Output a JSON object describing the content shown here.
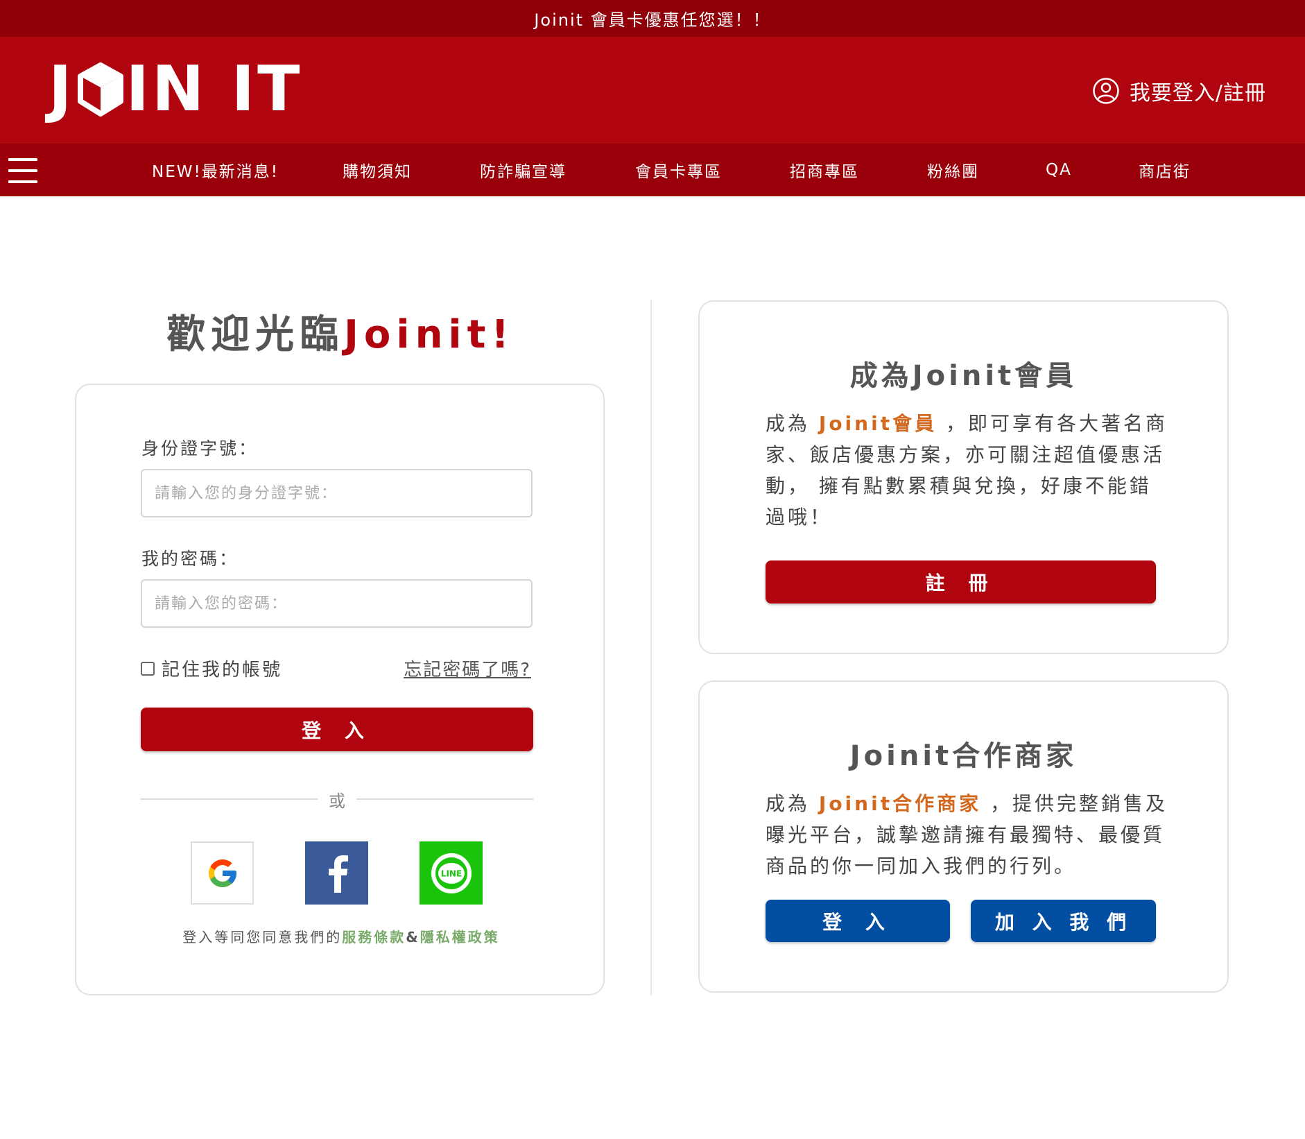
{
  "announcement": "Joinit 會員卡優惠任您選！！",
  "logo": {
    "left": "J",
    "middle": "IN IT"
  },
  "header": {
    "login_label": "我要登入/註冊"
  },
  "nav": {
    "items": [
      "NEW!最新消息!",
      "購物須知",
      "防詐騙宣導",
      "會員卡專區",
      "招商專區",
      "粉絲團",
      "QA",
      "商店街"
    ]
  },
  "welcome": {
    "prefix": "歡迎光臨",
    "brand": "Joinit!"
  },
  "login_form": {
    "id_label": "身份證字號：",
    "id_placeholder": "請輸入您的身分證字號：",
    "password_label": "我的密碼：",
    "password_placeholder": "請輸入您的密碼：",
    "remember_label": "記住我的帳號",
    "forgot_label": "忘記密碼了嗎?",
    "submit_label": "登 入",
    "or_label": "或",
    "agree_prefix": "登入等同您同意我們的",
    "terms_label": "服務條款",
    "amp": "&",
    "privacy_label": "隱私權政策",
    "line_badge": "LINE"
  },
  "member_card": {
    "title": "成為Joinit會員",
    "text_prefix": "成為 ",
    "highlight": "Joinit會員",
    "text_suffix": " ，即可享有各大著名商家、飯店優惠方案，亦可關注超值優惠活動， 擁有點數累積與兌換，好康不能錯過哦！",
    "button": "註 冊"
  },
  "partner_card": {
    "title": "Joinit合作商家",
    "text_prefix": "成為 ",
    "highlight": "Joinit合作商家",
    "text_suffix": " ，提供完整銷售及曝光平台，誠摯邀請擁有最獨特、最優質商品的你一同加入我們的行列。",
    "login_button": "登 入",
    "join_button": "加 入 我 們"
  },
  "colors": {
    "brand_red": "#b0050f",
    "dark_red": "#8f0009",
    "blue": "#024ea2",
    "highlight_orange": "#d2691e",
    "link_green": "#7aaa6a"
  }
}
